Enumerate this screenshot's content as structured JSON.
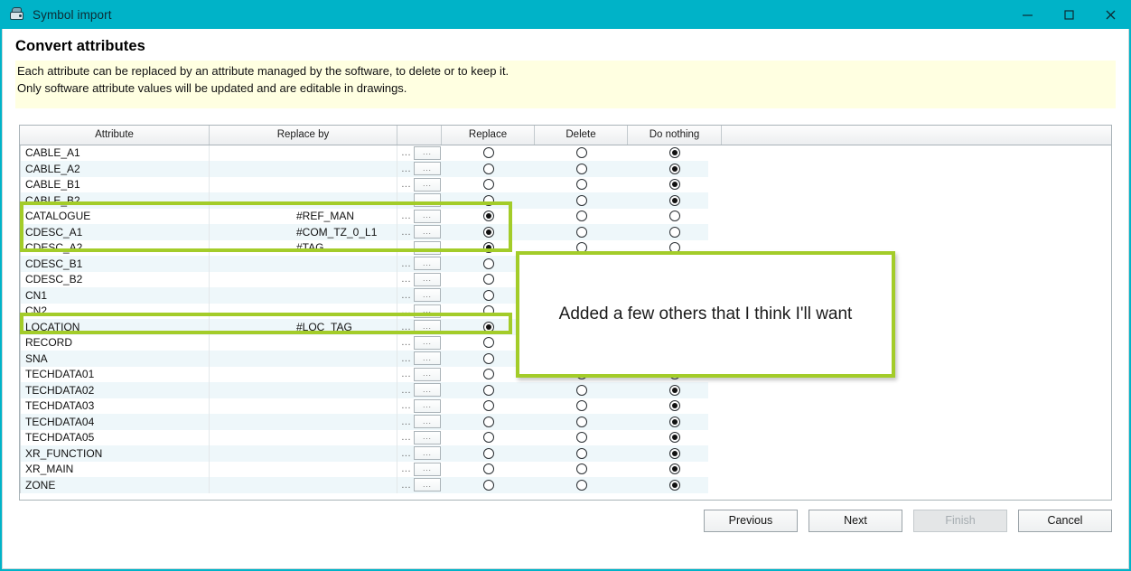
{
  "window": {
    "title": "Symbol import",
    "icon": "symbol-import-icon",
    "titlebar_color": "#00b3c8",
    "minimize_label": "–",
    "maximize_label": "☐",
    "close_label": "✕"
  },
  "header": {
    "title": "Convert attributes",
    "info_line_1": "Each attribute can be replaced by an attribute managed by the software, to delete or to keep it.",
    "info_line_2": "Only software attribute values will be updated and are editable in drawings.",
    "banner_color": "#ffffe1"
  },
  "grid": {
    "columns": [
      "Attribute",
      "Replace by",
      "",
      "Replace",
      "Delete",
      "Do nothing"
    ],
    "dots_label": "...",
    "ellipsis_label": "...",
    "rows": [
      {
        "attribute": "CABLE_A1",
        "replace_by": "",
        "selection": "do_nothing"
      },
      {
        "attribute": "CABLE_A2",
        "replace_by": "",
        "selection": "do_nothing"
      },
      {
        "attribute": "CABLE_B1",
        "replace_by": "",
        "selection": "do_nothing"
      },
      {
        "attribute": "CABLE_B2",
        "replace_by": "",
        "selection": "do_nothing"
      },
      {
        "attribute": "CATALOGUE",
        "replace_by": "#REF_MAN",
        "selection": "replace"
      },
      {
        "attribute": "CDESC_A1",
        "replace_by": "#COM_TZ_0_L1",
        "selection": "replace"
      },
      {
        "attribute": "CDESC_A2",
        "replace_by": "#TAG",
        "selection": "replace"
      },
      {
        "attribute": "CDESC_B1",
        "replace_by": "",
        "selection": "none"
      },
      {
        "attribute": "CDESC_B2",
        "replace_by": "",
        "selection": "none"
      },
      {
        "attribute": "CN1",
        "replace_by": "",
        "selection": "none"
      },
      {
        "attribute": "CN2",
        "replace_by": "",
        "selection": "none"
      },
      {
        "attribute": "LOCATION",
        "replace_by": "#LOC_TAG",
        "selection": "replace"
      },
      {
        "attribute": "RECORD",
        "replace_by": "",
        "selection": "do_nothing"
      },
      {
        "attribute": "SNA",
        "replace_by": "",
        "selection": "do_nothing"
      },
      {
        "attribute": "TECHDATA01",
        "replace_by": "",
        "selection": "do_nothing"
      },
      {
        "attribute": "TECHDATA02",
        "replace_by": "",
        "selection": "do_nothing"
      },
      {
        "attribute": "TECHDATA03",
        "replace_by": "",
        "selection": "do_nothing"
      },
      {
        "attribute": "TECHDATA04",
        "replace_by": "",
        "selection": "do_nothing"
      },
      {
        "attribute": "TECHDATA05",
        "replace_by": "",
        "selection": "do_nothing"
      },
      {
        "attribute": "XR_FUNCTION",
        "replace_by": "",
        "selection": "do_nothing"
      },
      {
        "attribute": "XR_MAIN",
        "replace_by": "",
        "selection": "do_nothing"
      },
      {
        "attribute": "ZONE",
        "replace_by": "",
        "selection": "do_nothing"
      }
    ]
  },
  "annotation": {
    "callout_text": "Added a few others that I think I'll want",
    "highlight_color": "#a3cc29"
  },
  "footer": {
    "previous_label": "Previous",
    "next_label": "Next",
    "finish_label": "Finish",
    "cancel_label": "Cancel"
  }
}
